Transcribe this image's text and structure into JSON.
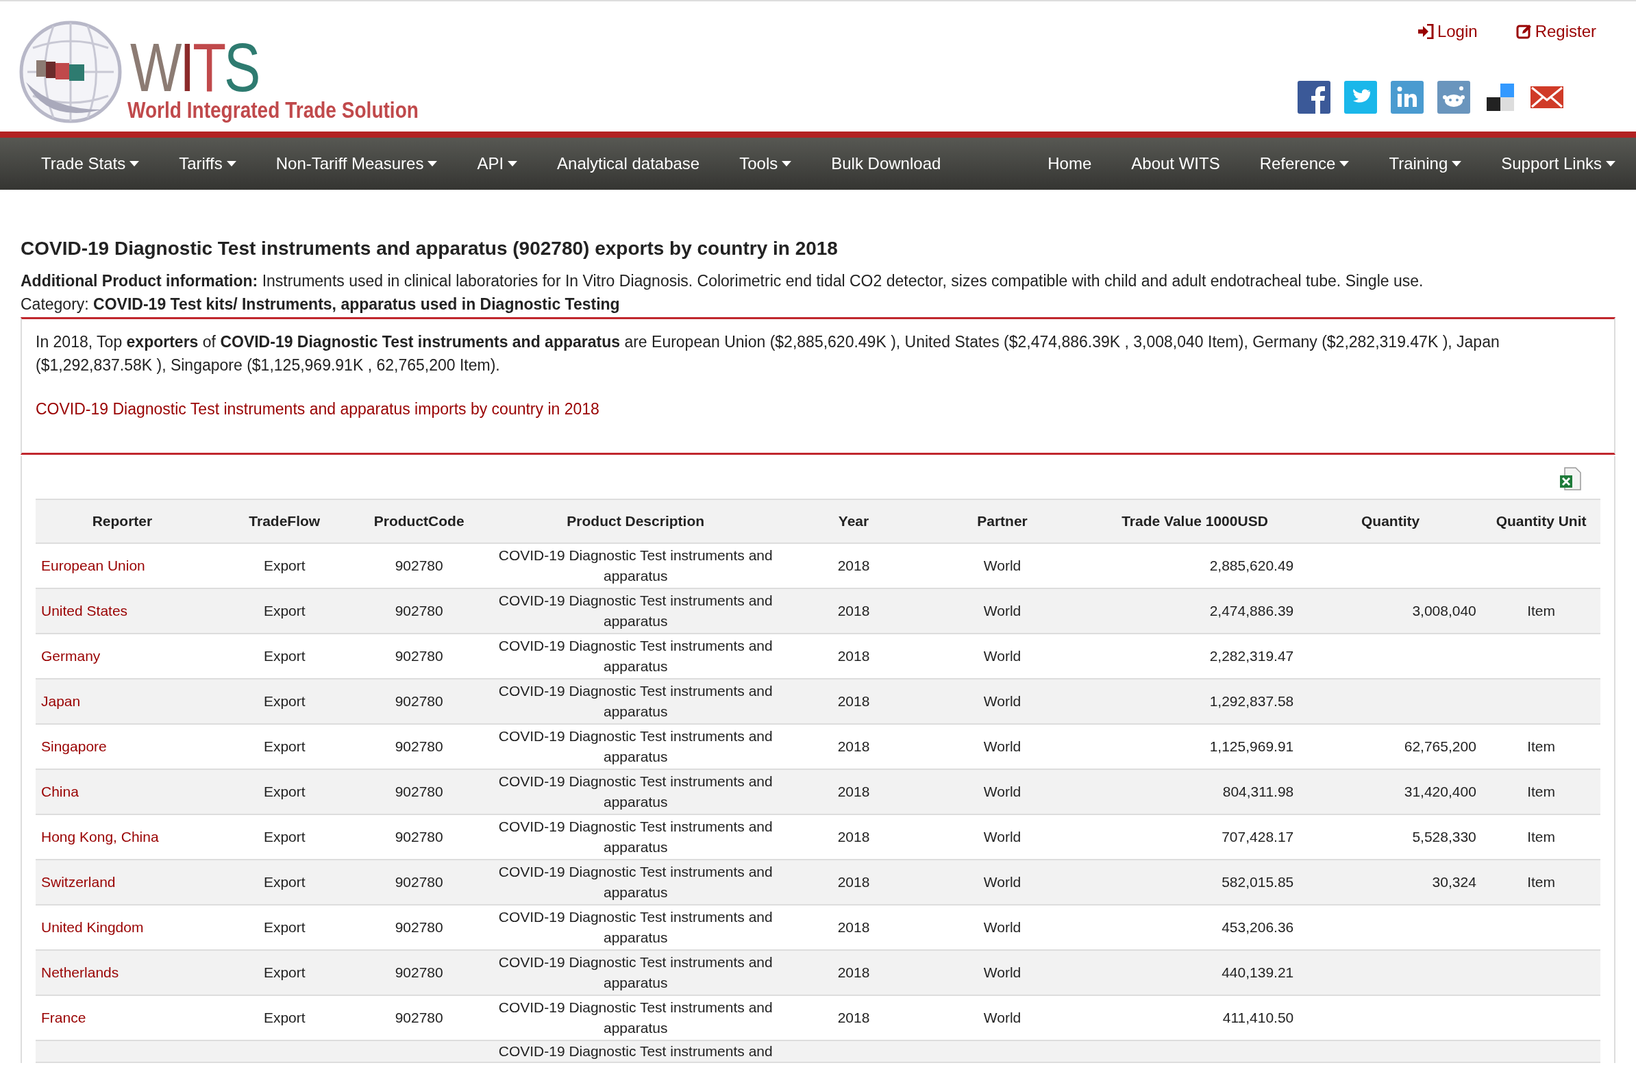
{
  "header": {
    "logo": {
      "letters": "WITS",
      "subtitle": "World Integrated Trade Solution"
    },
    "account_links": [
      {
        "label": "Login",
        "kind": "login"
      },
      {
        "label": "Register",
        "kind": "register"
      }
    ],
    "share_icons": [
      {
        "kind": "facebook"
      },
      {
        "kind": "twitter"
      },
      {
        "kind": "linkedin"
      },
      {
        "kind": "reddit"
      },
      {
        "kind": "delicious"
      },
      {
        "kind": "email"
      }
    ]
  },
  "nav": {
    "left": [
      {
        "label": "Trade Stats",
        "dropdown": true
      },
      {
        "label": "Tariffs",
        "dropdown": true
      },
      {
        "label": "Non-Tariff Measures",
        "dropdown": true
      },
      {
        "label": "API",
        "dropdown": true
      },
      {
        "label": "Analytical database",
        "dropdown": false
      },
      {
        "label": "Tools",
        "dropdown": true
      },
      {
        "label": "Bulk Download",
        "dropdown": false
      }
    ],
    "right": [
      {
        "label": "Home",
        "dropdown": false
      },
      {
        "label": "About WITS",
        "dropdown": false
      },
      {
        "label": "Reference",
        "dropdown": true
      },
      {
        "label": "Training",
        "dropdown": true
      },
      {
        "label": "Support Links",
        "dropdown": true
      }
    ]
  },
  "page": {
    "title": "COVID-19 Diagnostic Test instruments and apparatus (902780) exports by country in 2018",
    "additional_info": {
      "label": "Additional Product information:",
      "text": "Instruments used in clinical laboratories for In Vitro Diagnosis. Colorimetric end tidal CO2 detector, sizes compatible with child and adult endotracheal tube. Single use."
    },
    "category": {
      "label": "Category:",
      "value": "COVID-19 Test kits/ Instruments, apparatus used in Diagnostic Testing"
    },
    "summary": "In 2018, Top **exporters** of **COVID-19 Diagnostic Test instruments and apparatus** are European Union ($2,885,620.49K ), United States ($2,474,886.39K , 3,008,040 Item), Germany ($2,282,319.47K ), Japan ($1,292,837.58K ), Singapore ($1,125,969.91K , 62,765,200 Item).",
    "imports_link": "COVID-19 Diagnostic Test instruments and apparatus imports by country in 2018"
  },
  "table": {
    "columns": [
      "Reporter",
      "TradeFlow",
      "ProductCode",
      "Product Description",
      "Year",
      "Partner",
      "Trade Value 1000USD",
      "Quantity",
      "Quantity Unit"
    ],
    "rows": [
      {
        "reporter": "European Union",
        "flow": "Export",
        "code": "902780",
        "description": "COVID-19 Diagnostic Test instruments and apparatus",
        "year": "2018",
        "partner": "World",
        "value": "2,885,620.49"
      },
      {
        "reporter": "United States",
        "flow": "Export",
        "code": "902780",
        "description": "COVID-19 Diagnostic Test instruments and apparatus",
        "year": "2018",
        "partner": "World",
        "value": "2,474,886.39",
        "quantity": "3,008,040",
        "unit": "Item"
      },
      {
        "reporter": "Germany",
        "flow": "Export",
        "code": "902780",
        "description": "COVID-19 Diagnostic Test instruments and apparatus",
        "year": "2018",
        "partner": "World",
        "value": "2,282,319.47"
      },
      {
        "reporter": "Japan",
        "flow": "Export",
        "code": "902780",
        "description": "COVID-19 Diagnostic Test instruments and apparatus",
        "year": "2018",
        "partner": "World",
        "value": "1,292,837.58"
      },
      {
        "reporter": "Singapore",
        "flow": "Export",
        "code": "902780",
        "description": "COVID-19 Diagnostic Test instruments and apparatus",
        "year": "2018",
        "partner": "World",
        "value": "1,125,969.91",
        "quantity": "62,765,200",
        "unit": "Item"
      },
      {
        "reporter": "China",
        "flow": "Export",
        "code": "902780",
        "description": "COVID-19 Diagnostic Test instruments and apparatus",
        "year": "2018",
        "partner": "World",
        "value": "804,311.98",
        "quantity": "31,420,400",
        "unit": "Item"
      },
      {
        "reporter": "Hong Kong, China",
        "flow": "Export",
        "code": "902780",
        "description": "COVID-19 Diagnostic Test instruments and apparatus",
        "year": "2018",
        "partner": "World",
        "value": "707,428.17",
        "quantity": "5,528,330",
        "unit": "Item"
      },
      {
        "reporter": "Switzerland",
        "flow": "Export",
        "code": "902780",
        "description": "COVID-19 Diagnostic Test instruments and apparatus",
        "year": "2018",
        "partner": "World",
        "value": "582,015.85",
        "quantity": "30,324",
        "unit": "Item"
      },
      {
        "reporter": "United Kingdom",
        "flow": "Export",
        "code": "902780",
        "description": "COVID-19 Diagnostic Test instruments and apparatus",
        "year": "2018",
        "partner": "World",
        "value": "453,206.36"
      },
      {
        "reporter": "Netherlands",
        "flow": "Export",
        "code": "902780",
        "description": "COVID-19 Diagnostic Test instruments and apparatus",
        "year": "2018",
        "partner": "World",
        "value": "440,139.21"
      },
      {
        "reporter": "France",
        "flow": "Export",
        "code": "902780",
        "description": "COVID-19 Diagnostic Test instruments and apparatus",
        "year": "2018",
        "partner": "World",
        "value": "411,410.50"
      },
      {
        "description": "COVID-19 Diagnostic Test instruments and"
      }
    ]
  }
}
